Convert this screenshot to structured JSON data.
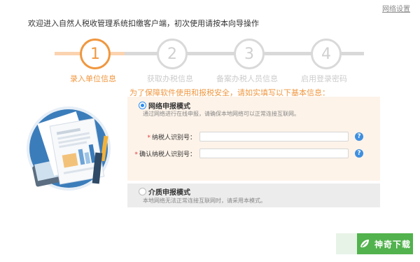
{
  "header": {
    "title": "欢迎进入自然人税收管理系统扣缴客户端，初次使用请按本向导操作",
    "network_settings": "网络设置"
  },
  "steps": [
    {
      "number": "1",
      "label": "录入单位信息",
      "state": "active"
    },
    {
      "number": "2",
      "label": "获取办税信息",
      "state": "inactive"
    },
    {
      "number": "3",
      "label": "备案办税人员信息",
      "state": "inactive"
    },
    {
      "number": "4",
      "label": "启用登录密码",
      "state": "inactive"
    }
  ],
  "notice": "为了保障软件使用和报税安全，请如实填写以下基本信息：",
  "modes": {
    "network": {
      "title": "网络申报模式",
      "desc": "通过网络进行在线申报，请确保本地网络可以正常连接互联网。",
      "selected": true
    },
    "media": {
      "title": "介质申报模式",
      "desc": "本地网络无法正常连接互联网时，请采用本模式。",
      "selected": false
    }
  },
  "fields": {
    "taxpayer_id": {
      "required_mark": "*",
      "label": "纳税人识别号：",
      "value": "",
      "placeholder": ""
    },
    "confirm_taxpayer_id": {
      "required_mark": "*",
      "label": "确认纳税人识别号：",
      "value": "",
      "placeholder": ""
    },
    "help_symbol": "?"
  },
  "watermark": {
    "text": "神奇下载"
  },
  "colors": {
    "accent": "#f0973f",
    "step_inactive": "#d9d9d9",
    "panel_active_bg": "#fdf3e9",
    "panel_inactive_bg": "#ececec",
    "radio_selected": "#2d8cf0",
    "help_icon": "#3f8fe0",
    "required": "#e4393c",
    "watermark_green": "#52b24d"
  }
}
